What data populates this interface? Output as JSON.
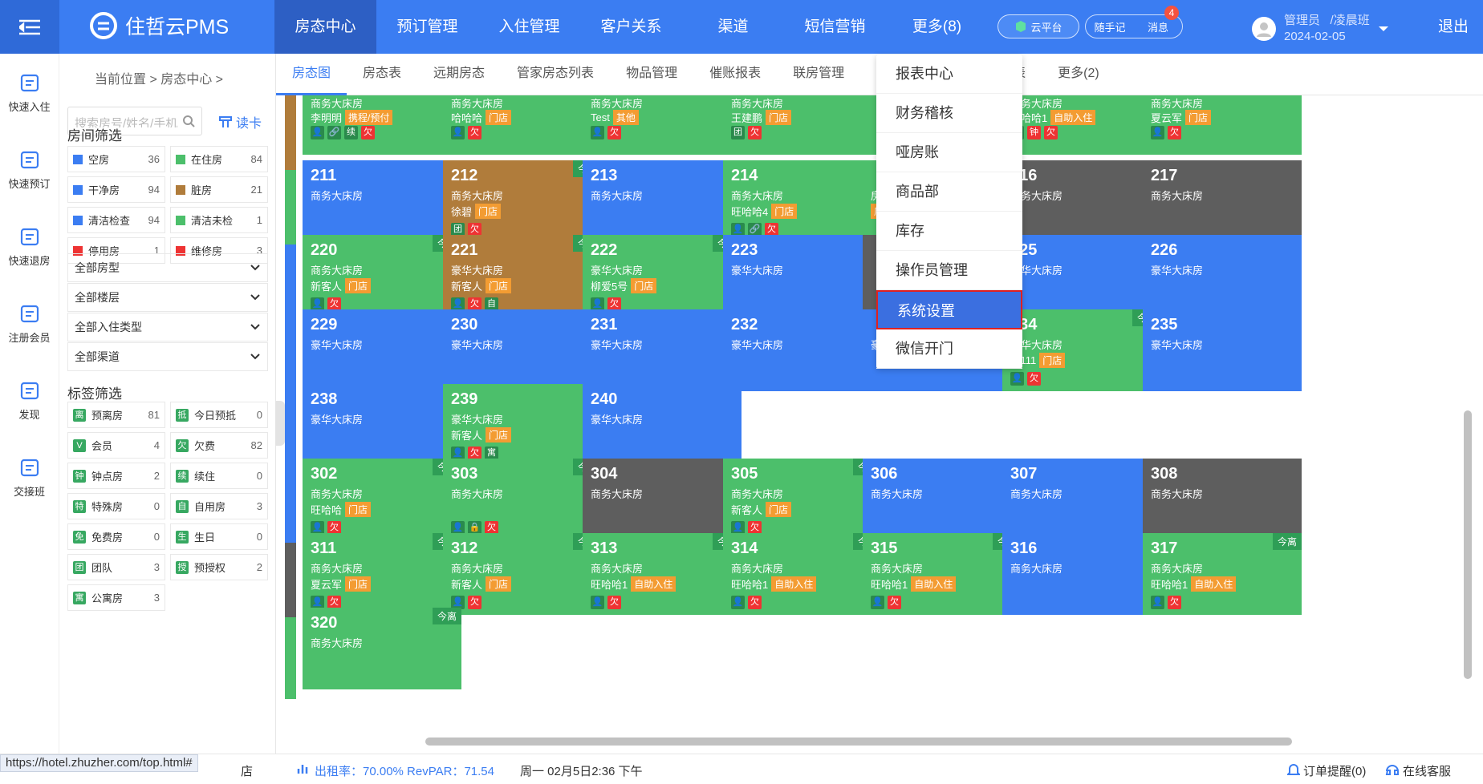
{
  "header": {
    "logo": "住哲云PMS",
    "nav": [
      "房态中心",
      "预订管理",
      "入住管理",
      "客户关系",
      "渠道",
      "短信营销",
      "更多(8)"
    ],
    "cloud": "云平台",
    "notes": "随手记",
    "messages": "消息",
    "msg_count": "4",
    "role": "管理员",
    "shift": "/凌晨班",
    "date": "2024-02-05",
    "logout": "退出"
  },
  "rail": [
    "快速入住",
    "快速预订",
    "快速退房",
    "注册会员",
    "发现",
    "交接班"
  ],
  "panel": {
    "crumb": "当前位置 > 房态中心 >",
    "search_placeholder": "搜索房号/姓名/手机",
    "read_card": "读卡",
    "room_filter_title": "房间筛选",
    "room_filters": [
      {
        "label": "空房",
        "count": "36",
        "color": "#3b7df2"
      },
      {
        "label": "在住房",
        "count": "84",
        "color": "#4cbf6b"
      },
      {
        "label": "干净房",
        "count": "94",
        "color": "#3b7df2"
      },
      {
        "label": "脏房",
        "count": "21",
        "color": "#b07c3b"
      },
      {
        "label": "清洁检查",
        "count": "94",
        "color": "#3b7df2"
      },
      {
        "label": "清洁未检",
        "count": "1",
        "color": "#4cbf6b"
      },
      {
        "label": "停用房",
        "count": "1",
        "color": "#e33"
      },
      {
        "label": "维修房",
        "count": "3",
        "color": "#e33"
      }
    ],
    "selects": [
      "全部房型",
      "全部楼层",
      "全部入住类型",
      "全部渠道"
    ],
    "tag_filter_title": "标签筛选",
    "tag_filters": [
      {
        "icon": "离",
        "label": "预离房",
        "count": "81"
      },
      {
        "icon": "抵",
        "label": "今日预抵",
        "count": "0"
      },
      {
        "icon": "V",
        "label": "会员",
        "count": "4"
      },
      {
        "icon": "欠",
        "label": "欠费",
        "count": "82"
      },
      {
        "icon": "钟",
        "label": "钟点房",
        "count": "2"
      },
      {
        "icon": "续",
        "label": "续住",
        "count": "0"
      },
      {
        "icon": "特",
        "label": "特殊房",
        "count": "0"
      },
      {
        "icon": "自",
        "label": "自用房",
        "count": "3"
      },
      {
        "icon": "免",
        "label": "免费房",
        "count": "0"
      },
      {
        "icon": "生",
        "label": "生日",
        "count": "0"
      },
      {
        "icon": "团",
        "label": "团队",
        "count": "3"
      },
      {
        "icon": "授",
        "label": "预授权",
        "count": "2"
      },
      {
        "icon": "寓",
        "label": "公寓房",
        "count": "3"
      }
    ]
  },
  "subtabs": [
    "房态图",
    "房态表",
    "远期房态",
    "管家房态列表",
    "物品管理",
    "催账报表",
    "联房管理",
    "表",
    "更多(2)"
  ],
  "dropdown": [
    "报表中心",
    "财务稽核",
    "哑房账",
    "商品部",
    "库存",
    "操作员管理",
    "系统设置",
    "微信开门"
  ],
  "rooms": [
    {
      "r": 0,
      "c": 0,
      "num": "",
      "type": "商务大床房",
      "guest": "李明明",
      "src": "携程/预付",
      "tags": [
        "u",
        "l",
        "续",
        "欠"
      ],
      "color": "green",
      "leave": ""
    },
    {
      "r": 0,
      "c": 1,
      "num": "",
      "type": "商务大床房",
      "guest": "哈哈哈",
      "src": "门店",
      "tags": [
        "u",
        "欠"
      ],
      "color": "green",
      "leave": ""
    },
    {
      "r": 0,
      "c": 2,
      "num": "",
      "type": "商务大床房",
      "guest": "Test",
      "src": "其他",
      "tags": [
        "u",
        "欠"
      ],
      "color": "green",
      "leave": ""
    },
    {
      "r": 0,
      "c": 3,
      "num": "",
      "type": "商务大床房",
      "guest": "王建鹏",
      "src": "门店",
      "tags": [
        "团",
        "欠"
      ],
      "color": "green",
      "leave": ""
    },
    {
      "r": 0,
      "c": 5,
      "num": "",
      "type": "商务大床房",
      "guest": "旺哈哈1",
      "src": "自助入住",
      "tags": [
        "u",
        "钟",
        "欠"
      ],
      "color": "green",
      "leave": ""
    },
    {
      "r": 0,
      "c": 6,
      "num": "",
      "type": "商务大床房",
      "guest": "夏云军",
      "src": "门店",
      "tags": [
        "u",
        "欠"
      ],
      "color": "green",
      "leave": ""
    },
    {
      "r": 1,
      "c": 0,
      "num": "211",
      "type": "商务大床房",
      "guest": "",
      "src": "",
      "tags": [],
      "color": "blue",
      "leave": ""
    },
    {
      "r": 1,
      "c": 1,
      "num": "212",
      "type": "商务大床房",
      "guest": "徐碧",
      "src": "门店",
      "tags": [
        "团",
        "欠"
      ],
      "color": "brown",
      "leave": "今离"
    },
    {
      "r": 1,
      "c": 2,
      "num": "213",
      "type": "商务大床房",
      "guest": "",
      "src": "",
      "tags": [],
      "color": "blue",
      "leave": ""
    },
    {
      "r": 1,
      "c": 3,
      "num": "214",
      "type": "商务大床房",
      "guest": "旺哈哈4",
      "src": "门店",
      "tags": [
        "u",
        "l",
        "欠"
      ],
      "color": "green",
      "leave": ""
    },
    {
      "r": 1,
      "c": 4,
      "num": "",
      "type": "房",
      "guest": "",
      "src": "店",
      "tags": [],
      "color": "green",
      "leave": "今离"
    },
    {
      "r": 1,
      "c": 5,
      "num": "216",
      "type": "商务大床房",
      "guest": "",
      "src": "",
      "tags": [],
      "color": "gray",
      "leave": ""
    },
    {
      "r": 1,
      "c": 6,
      "num": "217",
      "type": "商务大床房",
      "guest": "",
      "src": "",
      "tags": [],
      "color": "gray",
      "leave": ""
    },
    {
      "r": 2,
      "c": 0,
      "num": "220",
      "type": "商务大床房",
      "guest": "新客人",
      "src": "门店",
      "tags": [
        "u",
        "欠"
      ],
      "color": "green",
      "leave": "今离"
    },
    {
      "r": 2,
      "c": 1,
      "num": "221",
      "type": "豪华大床房",
      "guest": "新客人",
      "src": "门店",
      "tags": [
        "u",
        "欠",
        "自"
      ],
      "color": "brown",
      "leave": "今离"
    },
    {
      "r": 2,
      "c": 2,
      "num": "222",
      "type": "豪华大床房",
      "guest": "柳爱5号",
      "src": "门店",
      "tags": [
        "u",
        "欠"
      ],
      "color": "green",
      "leave": "今离"
    },
    {
      "r": 2,
      "c": 3,
      "num": "223",
      "type": "豪华大床房",
      "guest": "",
      "src": "",
      "tags": [],
      "color": "blue",
      "leave": ""
    },
    {
      "r": 2,
      "c": 4,
      "num": "",
      "type": "",
      "guest": "",
      "src": "",
      "tags": [],
      "color": "gray",
      "leave": ""
    },
    {
      "r": 2,
      "c": 5,
      "num": "225",
      "type": "豪华大床房",
      "guest": "",
      "src": "",
      "tags": [],
      "color": "blue",
      "leave": ""
    },
    {
      "r": 2,
      "c": 6,
      "num": "226",
      "type": "豪华大床房",
      "guest": "",
      "src": "",
      "tags": [],
      "color": "blue",
      "leave": ""
    },
    {
      "r": 3,
      "c": 0,
      "num": "229",
      "type": "豪华大床房",
      "guest": "",
      "src": "",
      "tags": [],
      "color": "blue",
      "leave": ""
    },
    {
      "r": 3,
      "c": 1,
      "num": "230",
      "type": "豪华大床房",
      "guest": "",
      "src": "",
      "tags": [],
      "color": "blue",
      "leave": ""
    },
    {
      "r": 3,
      "c": 2,
      "num": "231",
      "type": "豪华大床房",
      "guest": "",
      "src": "",
      "tags": [],
      "color": "blue",
      "leave": ""
    },
    {
      "r": 3,
      "c": 3,
      "num": "232",
      "type": "豪华大床房",
      "guest": "",
      "src": "",
      "tags": [],
      "color": "blue",
      "leave": ""
    },
    {
      "r": 3,
      "c": 4,
      "num": "",
      "type": "豪华大床房",
      "guest": "",
      "src": "",
      "tags": [],
      "color": "blue",
      "leave": ""
    },
    {
      "r": 3,
      "c": 5,
      "num": "234",
      "type": "豪华大床房",
      "guest": "11111",
      "src": "门店",
      "tags": [
        "u",
        "欠"
      ],
      "color": "green",
      "leave": "今离"
    },
    {
      "r": 3,
      "c": 6,
      "num": "235",
      "type": "豪华大床房",
      "guest": "",
      "src": "",
      "tags": [],
      "color": "blue",
      "leave": ""
    },
    {
      "r": 4,
      "c": 0,
      "num": "238",
      "type": "豪华大床房",
      "guest": "",
      "src": "",
      "tags": [],
      "color": "blue",
      "leave": ""
    },
    {
      "r": 4,
      "c": 1,
      "num": "239",
      "type": "豪华大床房",
      "guest": "新客人",
      "src": "门店",
      "tags": [
        "u",
        "欠",
        "寓"
      ],
      "color": "green",
      "leave": ""
    },
    {
      "r": 4,
      "c": 2,
      "num": "240",
      "type": "豪华大床房",
      "guest": "",
      "src": "",
      "tags": [],
      "color": "blue",
      "leave": ""
    },
    {
      "r": 5,
      "c": 0,
      "num": "302",
      "type": "商务大床房",
      "guest": "旺哈哈",
      "src": "门店",
      "tags": [
        "u",
        "欠"
      ],
      "color": "green",
      "leave": "今离"
    },
    {
      "r": 5,
      "c": 1,
      "num": "303",
      "type": "商务大床房",
      "guest": "",
      "src": "",
      "tags": [
        "u",
        "k",
        "欠"
      ],
      "color": "green",
      "leave": "今离"
    },
    {
      "r": 5,
      "c": 2,
      "num": "304",
      "type": "商务大床房",
      "guest": "",
      "src": "",
      "tags": [],
      "color": "gray",
      "leave": ""
    },
    {
      "r": 5,
      "c": 3,
      "num": "305",
      "type": "商务大床房",
      "guest": "新客人",
      "src": "门店",
      "tags": [
        "u",
        "欠"
      ],
      "color": "green",
      "leave": "今离"
    },
    {
      "r": 5,
      "c": 4,
      "num": "306",
      "type": "商务大床房",
      "guest": "",
      "src": "",
      "tags": [],
      "color": "blue",
      "leave": ""
    },
    {
      "r": 5,
      "c": 5,
      "num": "307",
      "type": "商务大床房",
      "guest": "",
      "src": "",
      "tags": [],
      "color": "blue",
      "leave": ""
    },
    {
      "r": 5,
      "c": 6,
      "num": "308",
      "type": "商务大床房",
      "guest": "",
      "src": "",
      "tags": [],
      "color": "gray",
      "leave": ""
    },
    {
      "r": 6,
      "c": 0,
      "num": "311",
      "type": "商务大床房",
      "guest": "夏云军",
      "src": "门店",
      "tags": [
        "u",
        "欠"
      ],
      "color": "green",
      "leave": "今离"
    },
    {
      "r": 6,
      "c": 1,
      "num": "312",
      "type": "商务大床房",
      "guest": "新客人",
      "src": "门店",
      "tags": [
        "u",
        "欠"
      ],
      "color": "green",
      "leave": "今离"
    },
    {
      "r": 6,
      "c": 2,
      "num": "313",
      "type": "商务大床房",
      "guest": "旺哈哈1",
      "src": "自助入住",
      "tags": [
        "u",
        "欠"
      ],
      "color": "green",
      "leave": "今离"
    },
    {
      "r": 6,
      "c": 3,
      "num": "314",
      "type": "商务大床房",
      "guest": "旺哈哈1",
      "src": "自助入住",
      "tags": [
        "u",
        "欠"
      ],
      "color": "green",
      "leave": "今离"
    },
    {
      "r": 6,
      "c": 4,
      "num": "315",
      "type": "商务大床房",
      "guest": "旺哈哈1",
      "src": "自助入住",
      "tags": [
        "u",
        "欠"
      ],
      "color": "green",
      "leave": "今离"
    },
    {
      "r": 6,
      "c": 5,
      "num": "316",
      "type": "商务大床房",
      "guest": "",
      "src": "",
      "tags": [],
      "color": "blue",
      "leave": ""
    },
    {
      "r": 6,
      "c": 6,
      "num": "317",
      "type": "商务大床房",
      "guest": "旺哈哈1",
      "src": "自助入住",
      "tags": [
        "u",
        "欠"
      ],
      "color": "green",
      "leave": "今离"
    },
    {
      "r": 7,
      "c": 0,
      "num": "320",
      "type": "商务大床房",
      "guest": "",
      "src": "",
      "tags": [],
      "color": "green",
      "leave": "今离"
    }
  ],
  "status": {
    "url": "https://hotel.zhuzher.com/top.html#",
    "store": "店",
    "occupancy": "出租率：70.00% RevPAR：71.54",
    "datetime": "周一 02月5日2:36 下午",
    "order_alert": "订单提醒(0)",
    "service": "在线客服"
  }
}
